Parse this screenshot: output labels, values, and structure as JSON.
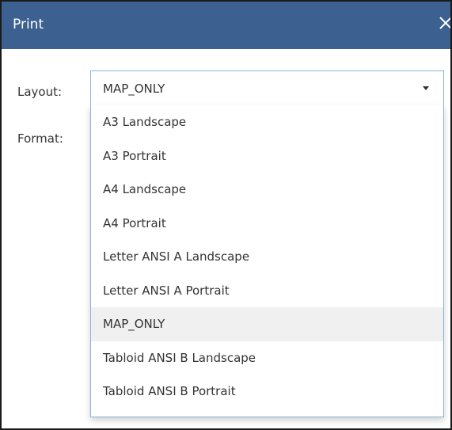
{
  "dialog": {
    "title": "Print",
    "close_label": "×"
  },
  "form": {
    "layout_label": "Layout:",
    "format_label": "Format:"
  },
  "layout_select": {
    "value": "MAP_ONLY",
    "options": [
      "A3 Landscape",
      "A3 Portrait",
      "A4 Landscape",
      "A4 Portrait",
      "Letter ANSI A Landscape",
      "Letter ANSI A Portrait",
      "MAP_ONLY",
      "Tabloid ANSI B Landscape",
      "Tabloid ANSI B Portrait"
    ],
    "selected_index": 6
  },
  "colors": {
    "titlebar": "#3c6190",
    "select_border": "#88b6d6",
    "highlight": "#f0f0f0"
  },
  "icons": {
    "close": "close-icon",
    "caret": "caret-down-icon"
  }
}
